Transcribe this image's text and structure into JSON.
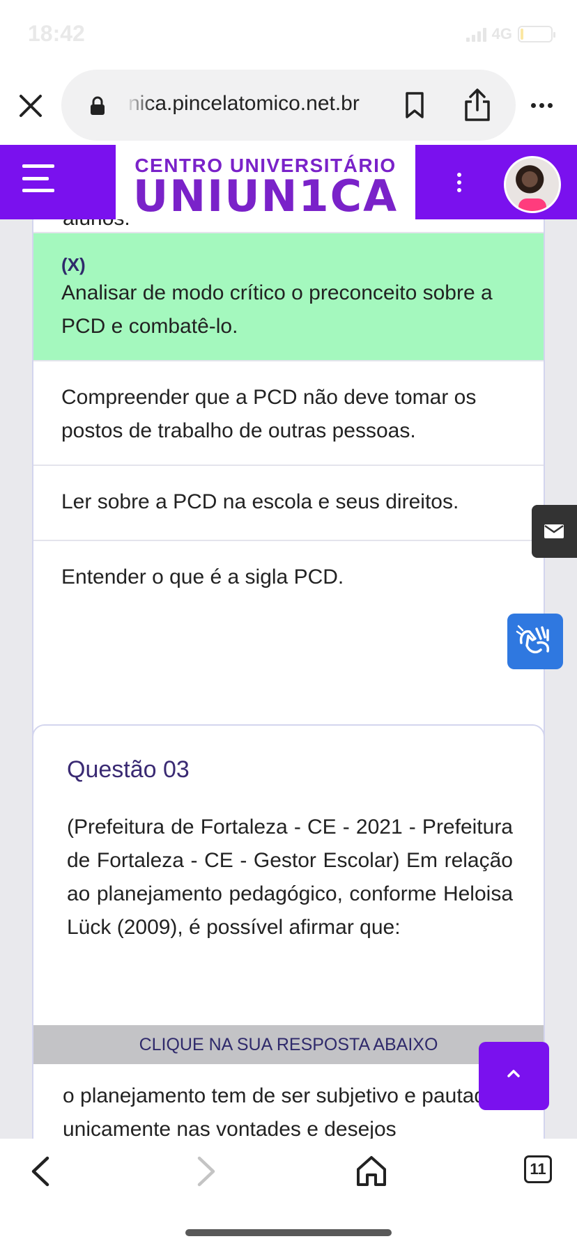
{
  "status_bar": {
    "time": "18:42",
    "network": "4G",
    "battery_level": 0.1
  },
  "browser": {
    "url_partial": "nica.pincelatomico.net.br"
  },
  "header": {
    "logo_top": "CENTRO UNIVERSITÁRIO",
    "logo_main": "UNIUN1CA",
    "brand_color": "#7a11ee"
  },
  "previous_question": {
    "cut_text": "alunos.",
    "options": [
      {
        "mark": "(X)",
        "text": "Analisar de modo crítico o preconceito sobre a PCD e combatê-lo.",
        "selected": true
      },
      {
        "mark": "",
        "text": "Compreender que a PCD não deve tomar os postos de trabalho de outras pessoas.",
        "selected": false
      },
      {
        "mark": "",
        "text": "Ler sobre a PCD na escola e seus direitos.",
        "selected": false
      },
      {
        "mark": "",
        "text": "Entender o que é a sigla PCD.",
        "selected": false
      }
    ]
  },
  "question": {
    "title": "Questão 03",
    "text": "(Prefeitura de Fortaleza - CE - 2021 - Prefeitura de Fortaleza - CE - Gestor Escolar) Em relação ao planejamento pedagógico, conforme Heloisa Lück (2009), é possível afirmar que:",
    "answer_banner": "CLIQUE NA SUA RESPOSTA ABAIXO",
    "first_answer": "o planejamento tem de ser subjetivo e pautado unicamente nas vontades e desejos"
  },
  "toolbar": {
    "tab_count": "11"
  }
}
